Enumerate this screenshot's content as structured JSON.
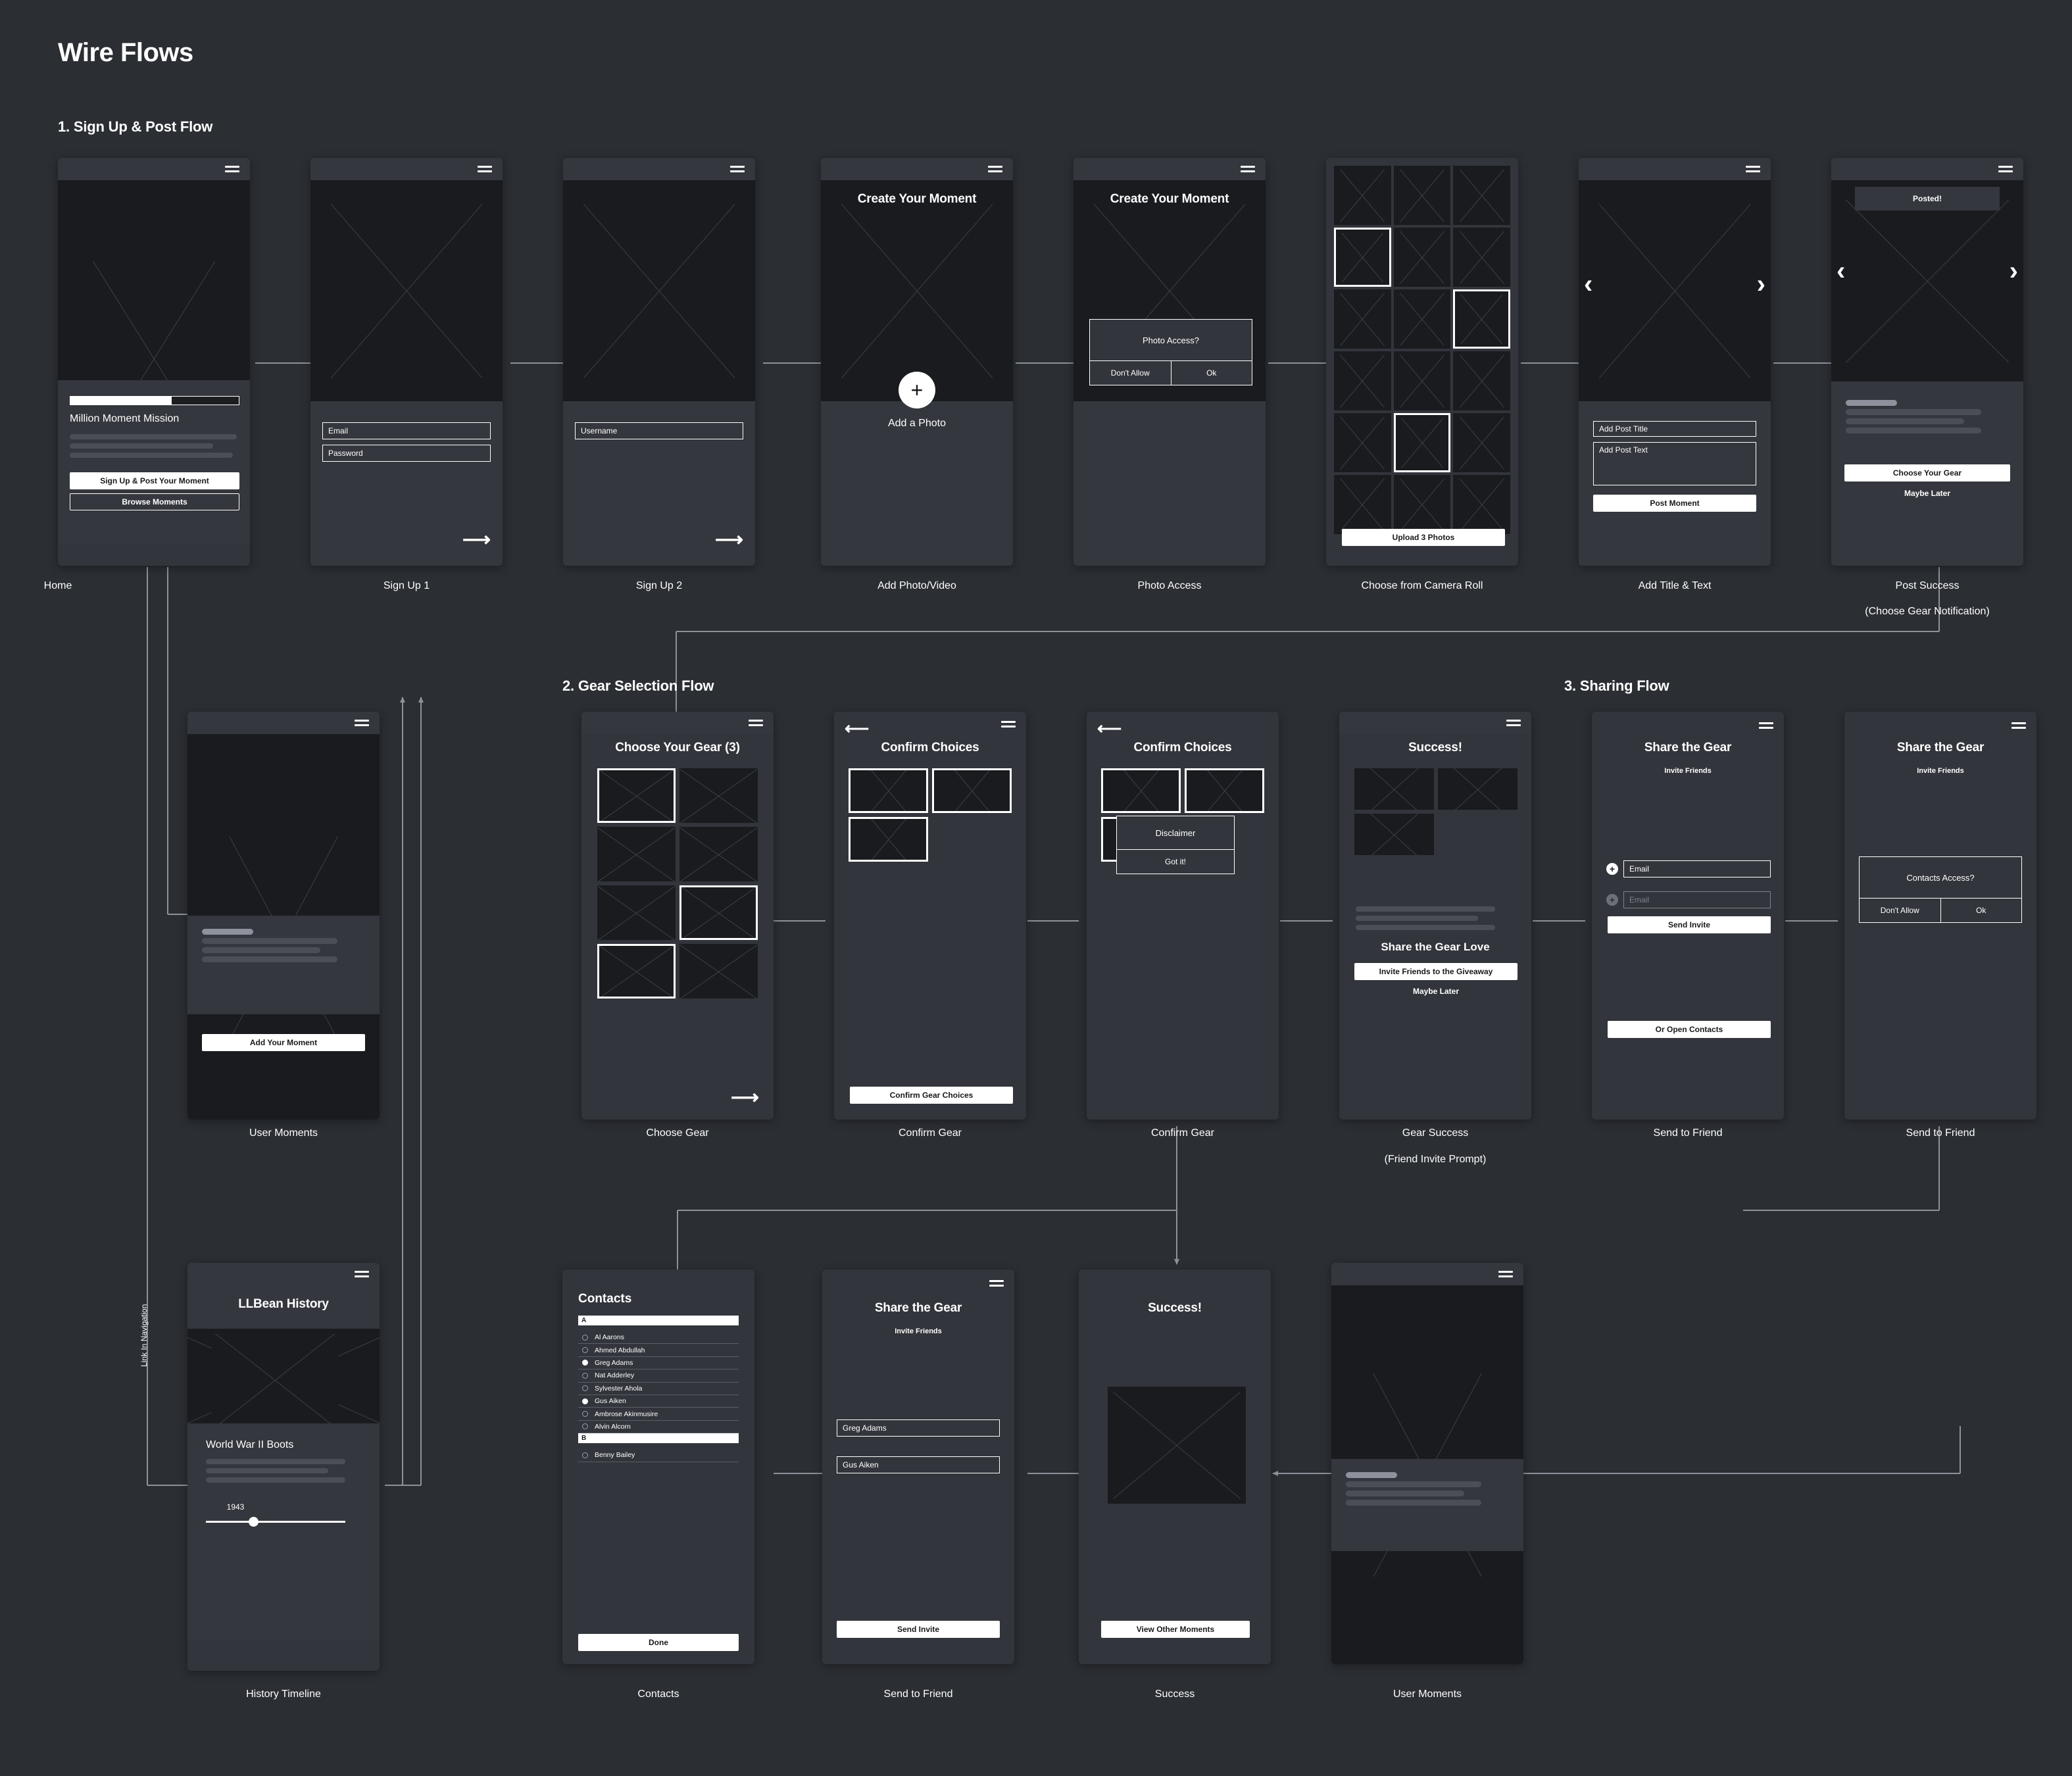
{
  "page": {
    "title": "Wire Flows"
  },
  "sections": [
    {
      "label": "1. Sign Up & Post Flow"
    },
    {
      "label": "2. Gear Selection Flow"
    },
    {
      "label": "3. Sharing Flow"
    }
  ],
  "vertical_label": "Link In Navigation",
  "colors": {
    "canvas": "#2b2e33",
    "phone": "#32353b",
    "panel": "#34373d",
    "image_placeholder": "#191b1f",
    "accent_white": "#ffffff",
    "wire": "#8e939b",
    "skeleton": "#4a4e56",
    "skeleton_light": "#8d929c"
  },
  "screens": {
    "home": {
      "caption": "Home",
      "heading": "Million Moment Mission",
      "primary_button": "Sign Up & Post Your Moment",
      "secondary_button": "Browse Moments",
      "progress_percent": 60
    },
    "signup1": {
      "caption": "Sign Up 1",
      "fields": [
        "Email",
        "Password"
      ],
      "next_icon": "arrow-right-icon"
    },
    "signup2": {
      "caption": "Sign Up 2",
      "fields": [
        "Username"
      ],
      "next_icon": "arrow-right-icon"
    },
    "add_photo": {
      "caption": "Add Photo/Video",
      "title": "Create Your Moment",
      "add_label": "Add a Photo",
      "plus_icon": "plus-icon"
    },
    "photo_access": {
      "caption": "Photo Access",
      "title": "Create Your Moment",
      "dialog_title": "Photo Access?",
      "dialog_deny": "Don't Allow",
      "dialog_allow": "Ok"
    },
    "camera_roll": {
      "caption": "Choose from Camera Roll",
      "upload_button": "Upload 3 Photos",
      "grid_rows": 6,
      "grid_cols": 3,
      "selected_cells": [
        3,
        8,
        13
      ]
    },
    "add_title_text": {
      "caption": "Add Title & Text",
      "title_field": "Add Post Title",
      "text_field": "Add Post Text",
      "post_button": "Post Moment",
      "prev_icon": "chevron-left-icon",
      "next_icon": "chevron-right-icon"
    },
    "post_success": {
      "caption": "Post Success\n(Choose Gear Notification)",
      "caption_line1": "Post Success",
      "caption_line2": "(Choose Gear Notification)",
      "badge": "Posted!",
      "primary_button": "Choose Your Gear",
      "secondary_button": "Maybe Later",
      "prev_icon": "chevron-left-icon",
      "next_icon": "chevron-right-icon"
    },
    "user_moments": {
      "caption": "User Moments",
      "add_button": "Add Your Moment"
    },
    "choose_gear": {
      "caption": "Choose Gear",
      "title": "Choose Your Gear (3)",
      "selected_cells": [
        0,
        5,
        6
      ],
      "next_icon": "arrow-right-icon"
    },
    "confirm_gear_1": {
      "caption": "Confirm Gear",
      "title": "Confirm Choices",
      "confirm_button": "Confirm Gear Choices",
      "back_icon": "back-arrow-icon"
    },
    "confirm_gear_2": {
      "caption": "Confirm Gear",
      "title": "Confirm Choices",
      "dialog_title": "Disclaimer",
      "dialog_action": "Got it!",
      "back_icon": "back-arrow-icon"
    },
    "gear_success": {
      "caption_line1": "Gear Success",
      "caption_line2": "(Friend Invite Prompt)",
      "title": "Success!",
      "subhead": "Share the Gear Love",
      "primary_button": "Invite Friends to the Giveaway",
      "secondary_button": "Maybe Later"
    },
    "send_to_friend_email": {
      "caption": "Send to Friend",
      "title": "Share the Gear",
      "subtitle": "Invite Friends",
      "field_1": "Email",
      "field_2": "Email",
      "send_button": "Send Invite",
      "contacts_button": "Or Open Contacts"
    },
    "send_to_friend_access": {
      "caption": "Send to Friend",
      "title": "Share the Gear",
      "subtitle": "Invite Friends",
      "dialog_title": "Contacts Access?",
      "dialog_deny": "Don't Allow",
      "dialog_allow": "Ok"
    },
    "history_timeline": {
      "caption": "History Timeline",
      "title": "LLBean History",
      "item_title": "World War II Boots",
      "year": "1943",
      "slider_percent": 33
    },
    "contacts": {
      "caption": "Contacts",
      "title": "Contacts",
      "groups": [
        {
          "letter": "A",
          "people": [
            {
              "name": "Al Aarons",
              "selected": false
            },
            {
              "name": "Ahmed Abdullah",
              "selected": false
            },
            {
              "name": "Greg Adams",
              "selected": true
            },
            {
              "name": "Nat Adderley",
              "selected": false
            },
            {
              "name": "Sylvester Ahola",
              "selected": false
            },
            {
              "name": "Gus Aiken",
              "selected": true
            },
            {
              "name": "Ambrose Akinmusire",
              "selected": false
            },
            {
              "name": "Alvin Alcorn",
              "selected": false
            }
          ]
        },
        {
          "letter": "B",
          "people": [
            {
              "name": "Benny Bailey",
              "selected": false
            }
          ]
        }
      ],
      "done_button": "Done"
    },
    "send_to_friend_names": {
      "caption": "Send to Friend",
      "title": "Share the Gear",
      "subtitle": "Invite Friends",
      "name_1": "Greg Adams",
      "name_2": "Gus Aiken",
      "send_button": "Send Invite"
    },
    "success": {
      "caption": "Success",
      "title": "Success!",
      "view_button": "View Other Moments"
    },
    "user_moments_2": {
      "caption": "User Moments"
    }
  }
}
